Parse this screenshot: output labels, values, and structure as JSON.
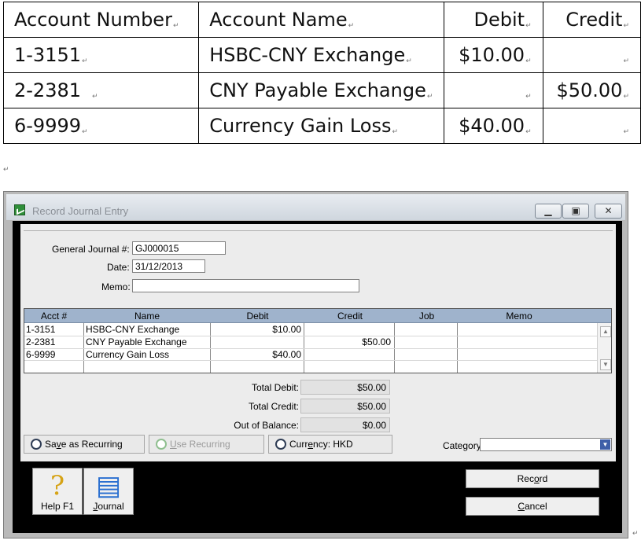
{
  "doc_table": {
    "headers": [
      "Account Number",
      "Account Name",
      "Debit",
      "Credit"
    ],
    "rows": [
      {
        "acct": "1-3151",
        "name": "HSBC-CNY Exchange",
        "debit": "$10.00",
        "credit": ""
      },
      {
        "acct": "2-2381",
        "name": "CNY Payable Exchange",
        "debit": "",
        "credit": "$50.00"
      },
      {
        "acct": "6-9999",
        "name": "Currency Gain Loss",
        "debit": "$40.00",
        "credit": ""
      }
    ],
    "para_mark": "↵"
  },
  "window": {
    "title": "Record Journal Entry",
    "form": {
      "general_journal_label": "General Journal #:",
      "general_journal_value": "GJ000015",
      "date_label": "Date:",
      "date_value": "31/12/2013",
      "memo_label": "Memo:",
      "memo_value": ""
    },
    "grid": {
      "columns": [
        "Acct #",
        "Name",
        "Debit",
        "Credit",
        "Job",
        "Memo"
      ],
      "rows": [
        {
          "acct": "1-3151",
          "name": "HSBC-CNY Exchange",
          "debit": "$10.00",
          "credit": "",
          "job": "",
          "memo": ""
        },
        {
          "acct": "2-2381",
          "name": "CNY Payable Exchange",
          "debit": "",
          "credit": "$50.00",
          "job": "",
          "memo": ""
        },
        {
          "acct": "6-9999",
          "name": "Currency Gain Loss",
          "debit": "$40.00",
          "credit": "",
          "job": "",
          "memo": ""
        }
      ]
    },
    "totals": {
      "total_debit_label": "Total Debit:",
      "total_debit": "$50.00",
      "total_credit_label": "Total Credit:",
      "total_credit": "$50.00",
      "out_of_balance_label": "Out of Balance:",
      "out_of_balance": "$0.00"
    },
    "toolbar": {
      "save_recurring": {
        "pre": "Sa",
        "u": "v",
        "post": "e as Recurring"
      },
      "use_recurring": {
        "pre": "",
        "u": "U",
        "post": "se Recurring"
      },
      "currency": {
        "pre": "Curr",
        "u": "e",
        "post": "ncy:  HKD"
      },
      "category_label": "Category:",
      "category_value": ""
    },
    "buttons": {
      "help": "Help F1",
      "journal": {
        "pre": "",
        "u": "J",
        "post": "ournal"
      },
      "record": {
        "pre": "Rec",
        "u": "o",
        "post": "rd"
      },
      "cancel": {
        "pre": "",
        "u": "C",
        "post": "ancel"
      }
    }
  },
  "colors": {
    "grid_header": "#9fb3cc",
    "frame": "#000000",
    "panel": "#ececec"
  },
  "icons": [
    "app-icon",
    "minimize-icon",
    "maximize-icon",
    "close-icon",
    "scroll-up-icon",
    "scroll-down-icon",
    "save-recurring-icon",
    "use-recurring-icon",
    "currency-icon",
    "dropdown-icon",
    "help-icon",
    "journal-icon"
  ]
}
